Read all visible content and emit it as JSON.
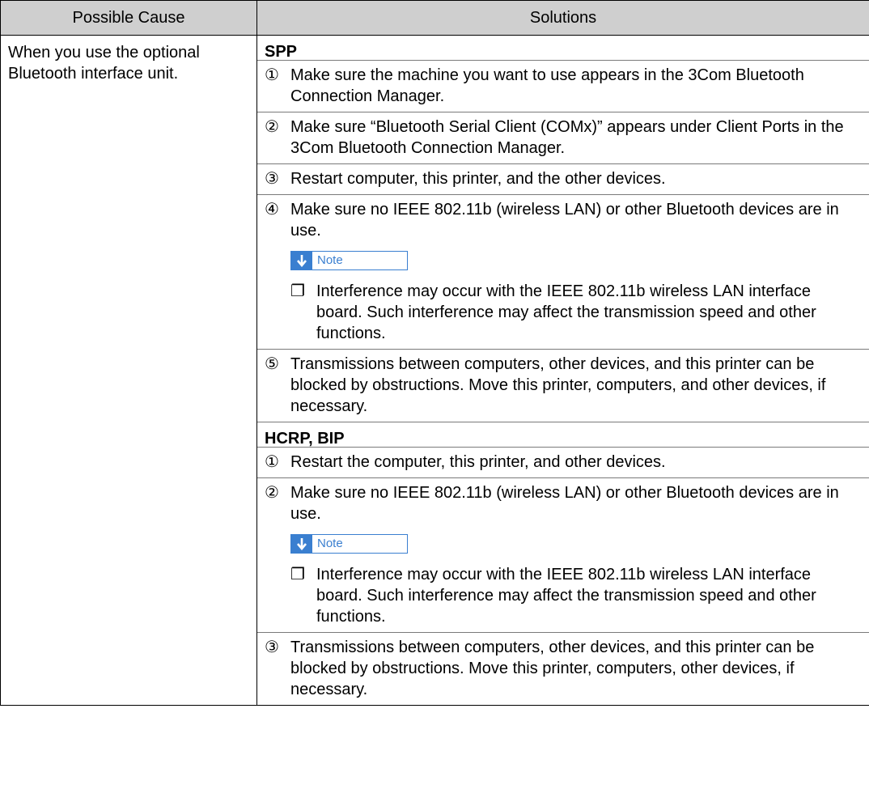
{
  "table": {
    "headers": [
      "Possible Cause",
      "Solutions"
    ],
    "cause": "When you use the optional Bluetooth interface unit.",
    "sections": [
      {
        "title": "SPP",
        "steps": [
          {
            "num": "①",
            "text": "Make sure the machine you want to use appears in the 3Com Bluetooth Connection Manager."
          },
          {
            "num": "②",
            "text": "Make sure “Bluetooth Serial Client (COMx)” appears under Client Ports in the 3Com Bluetooth Connection Manager."
          },
          {
            "num": "③",
            "text": "Restart computer, this printer, and the other devices."
          },
          {
            "num": "④",
            "text": "Make sure no IEEE 802.11b (wireless LAN) or other Bluetooth devices are in use."
          },
          {
            "num": "⑤",
            "text": "Transmissions between computers, other devices, and this printer can be blocked by obstructions. Move this printer, computers, and other devices, if necessary."
          }
        ],
        "note": {
          "label": "Note",
          "bullet": "❐",
          "text": "Interference may occur with the IEEE 802.11b wireless LAN interface board. Such interference may affect the transmission speed and other functions."
        }
      },
      {
        "title": "HCRP, BIP",
        "steps": [
          {
            "num": "①",
            "text": "Restart the computer, this printer, and other devices."
          },
          {
            "num": "②",
            "text": "Make sure no IEEE 802.11b (wireless LAN) or other Bluetooth devices are in use."
          },
          {
            "num": "③",
            "text": "Transmissions between computers, other devices, and this printer can be blocked by obstructions. Move this printer, computers, other devices, if necessary."
          }
        ],
        "note": {
          "label": "Note",
          "bullet": "❐",
          "text": "Interference may occur with the IEEE 802.11b wireless LAN interface board. Such interference may affect the transmission speed and other functions."
        }
      }
    ]
  },
  "icons": {
    "note_arrow": "down-arrow-icon",
    "note_accent": "#3a7fd0",
    "header_bg": "#cfcfcf"
  }
}
